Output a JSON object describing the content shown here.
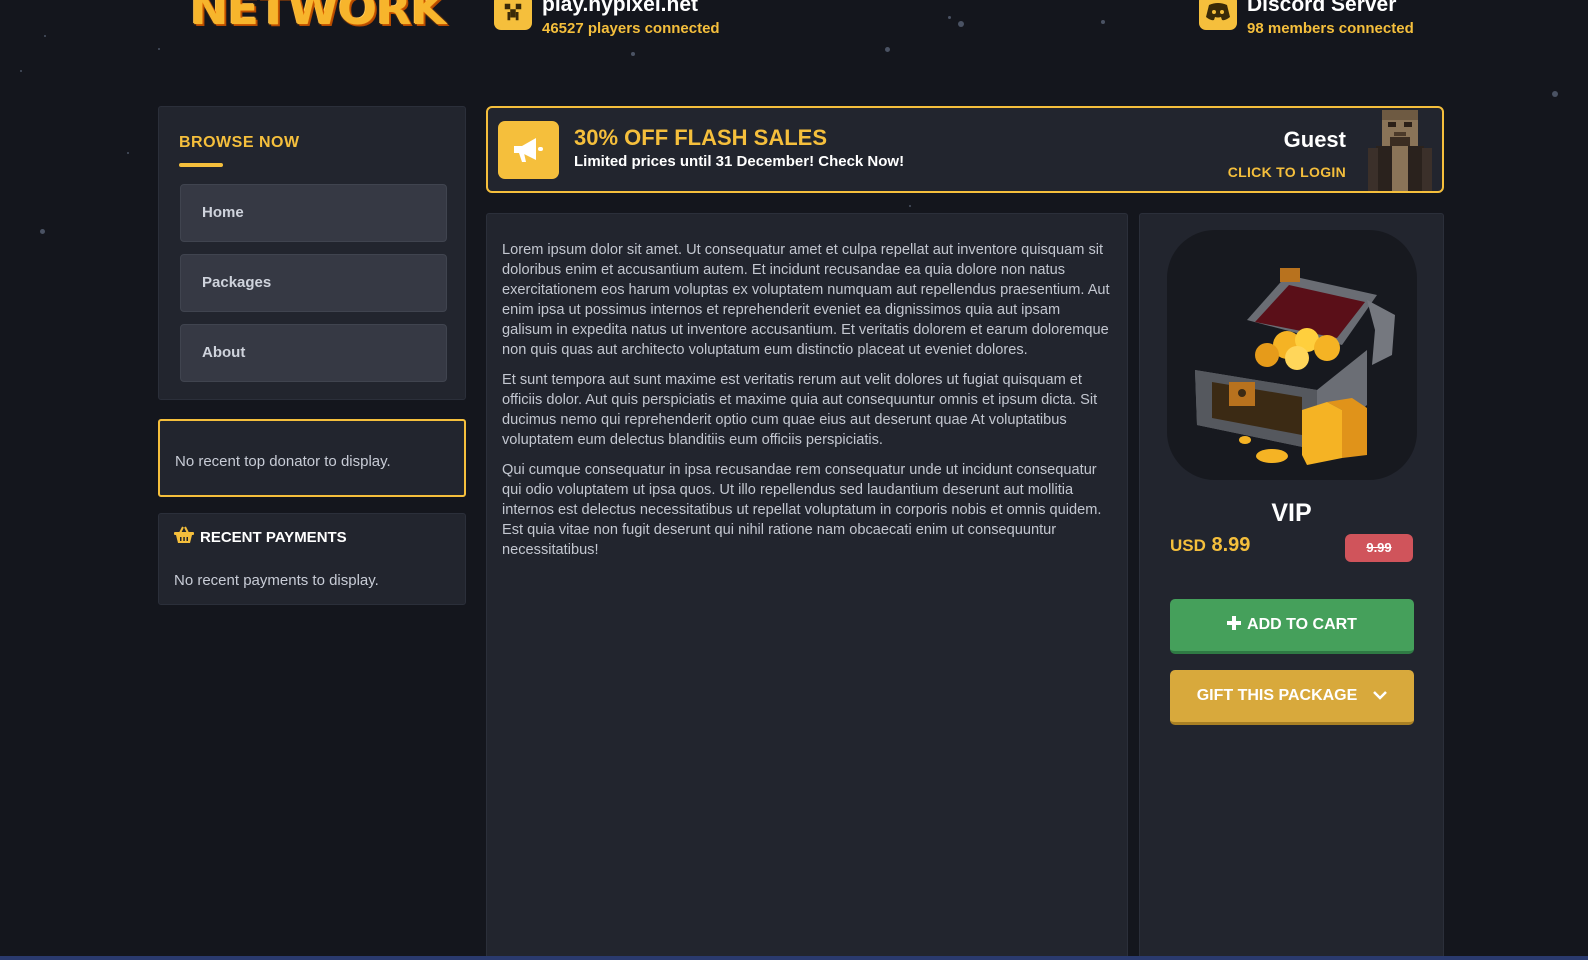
{
  "header": {
    "logo_text": "NETWORK",
    "server": {
      "title": "play.hypixel.net",
      "subtitle": "46527 players connected",
      "icon": "creeper-icon"
    },
    "discord": {
      "title": "Discord Server",
      "subtitle": "98 members connected",
      "icon": "discord-icon"
    }
  },
  "sidebar": {
    "browse_title": "BROWSE NOW",
    "items": [
      {
        "label": "Home"
      },
      {
        "label": "Packages"
      },
      {
        "label": "About"
      }
    ],
    "top_donator_empty": "No recent top donator to display.",
    "recent_payments_title": "RECENT PAYMENTS",
    "recent_payments_empty": "No recent payments to display."
  },
  "banner": {
    "title": "30% OFF FLASH SALES",
    "subtitle": "Limited prices until 31 December! Check Now!",
    "icon": "megaphone-icon"
  },
  "user": {
    "name": "Guest",
    "login_label": "CLICK TO LOGIN"
  },
  "description": {
    "paragraphs": [
      "Lorem ipsum dolor sit amet. Ut consequatur amet et culpa repellat aut inventore quisquam sit doloribus enim et accusantium autem. Et incidunt recusandae ea quia dolore non natus exercitationem eos harum voluptas ex voluptatem numquam aut repellendus praesentium. Aut enim ipsa ut possimus internos et reprehenderit eveniet ea dignissimos quia aut ipsam galisum in expedita natus ut inventore accusantium. Et veritatis dolorem et earum doloremque non quis quas aut architecto voluptatum eum distinctio placeat ut eveniet dolores.",
      "Et sunt tempora aut sunt maxime est veritatis rerum aut velit dolores ut fugiat quisquam et officiis dolor. Aut quis perspiciatis et maxime quia aut consequuntur omnis et ipsum dicta. Sit ducimus nemo qui reprehenderit optio cum quae eius aut deserunt quae At voluptatibus voluptatem eum delectus blanditiis eum officiis perspiciatis.",
      "Qui cumque consequatur in ipsa recusandae rem consequatur unde ut incidunt consequatur qui odio voluptatem ut ipsa quos. Ut illo repellendus sed laudantium deserunt aut mollitia internos est delectus necessitatibus ut repellat voluptatum in corporis nobis et omnis quidem. Est quia vitae non fugit deserunt qui nihil ratione nam obcaecati enim ut consequuntur necessitatibus!"
    ]
  },
  "package": {
    "name": "VIP",
    "currency": "USD",
    "price": "8.99",
    "old_price": "9.99",
    "add_to_cart_label": "ADD TO CART",
    "gift_label": "GIFT THIS PACKAGE",
    "image": "treasure-chest-icon"
  },
  "colors": {
    "accent": "#f5bf3c",
    "background": "#14161d",
    "panel": "#22252e",
    "cart": "#45a05b",
    "gift": "#d8a93c",
    "old_price": "#d0545b"
  }
}
